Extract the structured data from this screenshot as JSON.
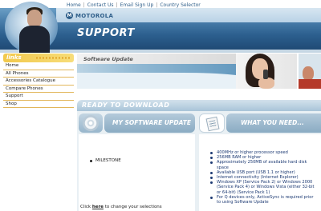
{
  "header": {
    "nav": [
      "Home",
      "Contact Us",
      "Email Sign Up",
      "Country Selector"
    ],
    "logo_text": "MOTOROLA",
    "logo_icon": "motorola-batwing-icon",
    "section_title": "SUPPORT"
  },
  "sidebar": {
    "title": "links",
    "items": [
      "Home",
      "All Phones",
      "Accessories Catalogue",
      "Compare Phones",
      "Support",
      "Shop"
    ]
  },
  "banner": {
    "label": "Software Update"
  },
  "main": {
    "ready_title": "READY TO DOWNLOAD",
    "left_panel": {
      "title": "MY SOFTWARE UPDATE",
      "icon": "cd-icon",
      "items": [
        "MILESTONE"
      ],
      "footer_prefix": "Click ",
      "footer_link": "here",
      "footer_suffix": " to change your selections"
    },
    "right_panel": {
      "title": "WHAT YOU NEED...",
      "icon": "document-icon",
      "requirements": [
        "400MHz or higher processor speed",
        "256MB RAM or higher",
        "Approximately 250MB of available hard disk space",
        "Available USB port (USB 1.1 or higher)",
        "Internet connectivity (Internet Explorer)",
        "Windows XP (Service Pack 2) or Windows 2000 (Service Pack 4) or Windows Vista (either 32-bit or 64-bit) (Service Pack 1)",
        "For Q devices only, ActiveSync is required prior to using Software Update"
      ]
    }
  },
  "colors": {
    "brand_blue": "#2c5f8e",
    "links_yellow": "#f2c94c",
    "requirement_text": "#1d3a73"
  }
}
